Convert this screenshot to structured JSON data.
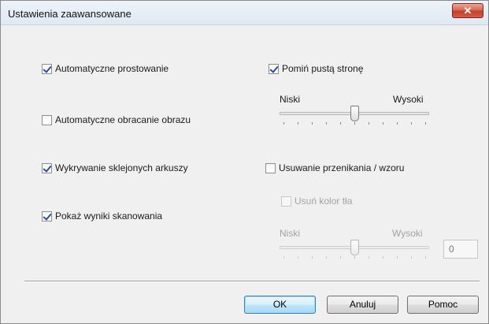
{
  "window": {
    "title": "Ustawienia zaawansowane",
    "close_glyph": "✕"
  },
  "left": {
    "auto_deskew": {
      "label": "Automatyczne prostowanie",
      "checked": true
    },
    "auto_rotate": {
      "label": "Automatyczne obracanie obrazu",
      "checked": false
    },
    "multifeed": {
      "label": "Wykrywanie sklejonych arkuszy",
      "checked": true
    },
    "show_results": {
      "label": "Pokaż wyniki skanowania",
      "checked": true
    }
  },
  "right": {
    "skip_blank": {
      "label": "Pomiń pustą stronę",
      "checked": true
    },
    "blank_slider": {
      "low": "Niski",
      "high": "Wysoki",
      "level": 0.5
    },
    "bleed_through": {
      "label": "Usuwanie przenikania / wzoru",
      "checked": false
    },
    "remove_bg": {
      "label": "Usuń kolor tła",
      "checked": false,
      "enabled": false
    },
    "bg_slider": {
      "low": "Niski",
      "high": "Wysoki",
      "level": 0.5,
      "enabled": false
    },
    "bg_value": "0"
  },
  "buttons": {
    "ok": "OK",
    "cancel": "Anuluj",
    "help": "Pomoc"
  }
}
